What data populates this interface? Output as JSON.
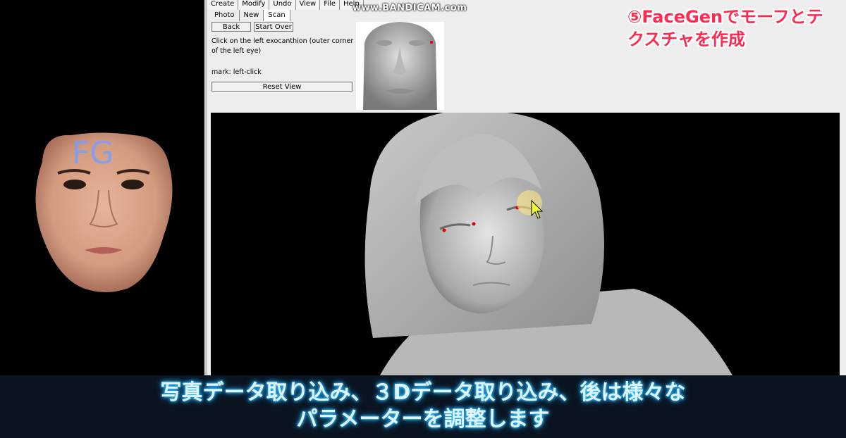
{
  "watermark": "www.BANDICAM.com",
  "overlay_title": "⑤FaceGenでモーフとテクスチャを作成",
  "subtitle_line1": "写真データ取り込み、３Dデータ取り込み、後は様々な",
  "subtitle_line2": "パラメーターを調整します",
  "left_panel": {
    "forehead_text": "FG"
  },
  "menu": [
    "Create",
    "Modify",
    "Undo",
    "View",
    "File",
    "Help"
  ],
  "subtabs": [
    "Photo",
    "New",
    "Scan"
  ],
  "buttons": {
    "back": "Back",
    "start_over": "Start Over",
    "reset_view": "Reset View"
  },
  "instruction": "Click on the left exocanthion (outer corner of the left eye)",
  "mark_hint": "mark: left-click",
  "colors": {
    "overlay_title": "#ff2a4f",
    "subtitle_glow": "#2cb8ff",
    "marker": "#e00000",
    "app_bg": "#ededed"
  }
}
